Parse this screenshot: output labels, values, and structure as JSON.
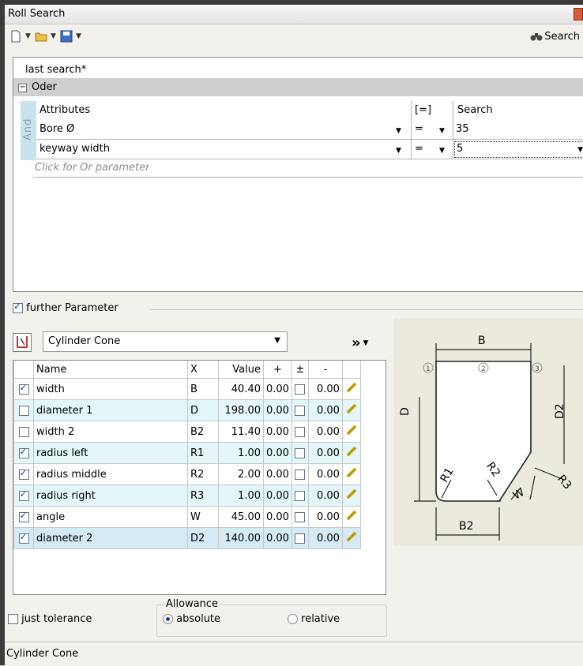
{
  "window": {
    "title": "Roll Search"
  },
  "toolbar": {
    "search_label": "Search"
  },
  "query": {
    "last_search": "last search*",
    "group_label": "Oder",
    "and_label": "And",
    "headers": {
      "attributes": "Attributes",
      "operator": "[=]",
      "search": "Search"
    },
    "rows": [
      {
        "attribute": "Bore Ø",
        "operator": "=",
        "value": "35"
      },
      {
        "attribute": "keyway width",
        "operator": "=",
        "value": "5"
      }
    ],
    "or_placeholder": "Click for Or parameter"
  },
  "further": {
    "label": "further Parameter",
    "checked": true
  },
  "shape": {
    "selected": "Cylinder Cone"
  },
  "grid": {
    "headers": {
      "name": "Name",
      "x": "X",
      "value": "Value",
      "plus": "+",
      "pm": "±",
      "minus": "-"
    },
    "rows": [
      {
        "checked": true,
        "name": "width",
        "x": "B",
        "value": "40.40",
        "plus": "0.00",
        "minus": "0.00"
      },
      {
        "checked": false,
        "name": "diameter 1",
        "x": "D",
        "value": "198.00",
        "plus": "0.00",
        "minus": "0.00"
      },
      {
        "checked": false,
        "name": "width 2",
        "x": "B2",
        "value": "11.40",
        "plus": "0.00",
        "minus": "0.00"
      },
      {
        "checked": true,
        "name": "radius left",
        "x": "R1",
        "value": "1.00",
        "plus": "0.00",
        "minus": "0.00"
      },
      {
        "checked": true,
        "name": "radius middle",
        "x": "R2",
        "value": "2.00",
        "plus": "0.00",
        "minus": "0.00"
      },
      {
        "checked": true,
        "name": "radius right",
        "x": "R3",
        "value": "1.00",
        "plus": "0.00",
        "minus": "0.00"
      },
      {
        "checked": true,
        "name": "angle",
        "x": "W",
        "value": "45.00",
        "plus": "0.00",
        "minus": "0.00"
      },
      {
        "checked": true,
        "name": "diameter 2",
        "x": "D2",
        "value": "140.00",
        "plus": "0.00",
        "minus": "0.00"
      }
    ]
  },
  "drawing": {
    "labels": {
      "b": "B",
      "d": "D",
      "d2": "D2",
      "b2": "B2",
      "r1": "R1",
      "r2": "R2",
      "r3": "R3",
      "w": "W",
      "p1": "1",
      "p2": "2",
      "p3": "3"
    }
  },
  "options": {
    "just_tolerance": "just tolerance",
    "allowance_label": "Allowance",
    "absolute": "absolute",
    "relative": "relative",
    "selected": "absolute"
  },
  "status": {
    "text": "Cylinder Cone"
  }
}
